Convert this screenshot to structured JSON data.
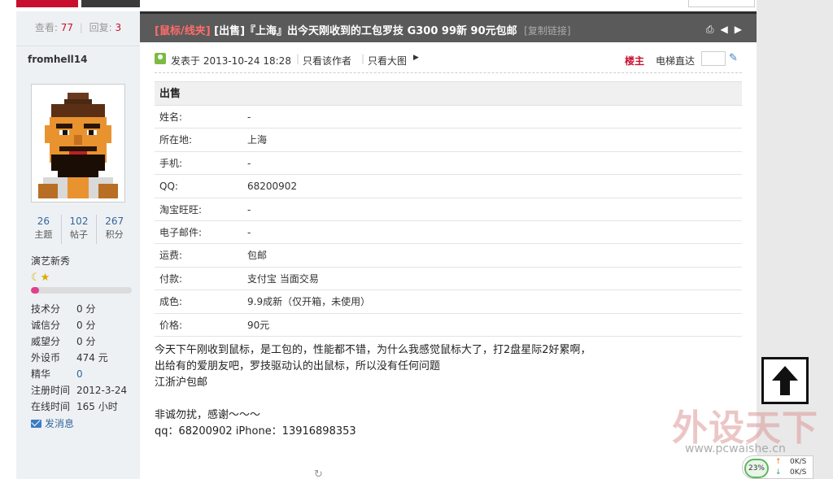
{
  "sidebar": {
    "views_label": "查看:",
    "views": "77",
    "replies_label": "回复:",
    "replies": "3",
    "username": "fromhell14",
    "counts": [
      {
        "num": "26",
        "label": "主题"
      },
      {
        "num": "102",
        "label": "帖子"
      },
      {
        "num": "267",
        "label": "积分"
      }
    ],
    "rank": "演艺新秀",
    "rank_stars": "☾★",
    "progress_fraction": 0.08,
    "info": [
      {
        "key": "技术分",
        "value": "0 分"
      },
      {
        "key": "诚信分",
        "value": "0 分"
      },
      {
        "key": "威望分",
        "value": "0 分"
      },
      {
        "key": "外设币",
        "value": "474 元"
      },
      {
        "key": "精华",
        "value": "0"
      },
      {
        "key": "注册时间",
        "value": "2012-3-24"
      },
      {
        "key": "在线时间",
        "value": "165 小时"
      }
    ],
    "send_message": "发消息"
  },
  "thread": {
    "category": "[鼠标/线夹]",
    "title": "[出售]『上海』出今天刚收到的工包罗技 G300 99新 90元包邮",
    "copy_link": "[复制链接]"
  },
  "post": {
    "posted_at": "发表于 2013-10-24 18:28",
    "only_author": "只看该作者",
    "only_big_image": "只看大图",
    "owner_label": "楼主",
    "elevator_label": "电梯直达"
  },
  "sale_table": {
    "header": "出售",
    "rows": [
      {
        "key": "姓名:",
        "value": "-"
      },
      {
        "key": "所在地:",
        "value": "上海"
      },
      {
        "key": "手机:",
        "value": "-"
      },
      {
        "key": "QQ:",
        "value": "68200902"
      },
      {
        "key": "淘宝旺旺:",
        "value": "-"
      },
      {
        "key": "电子邮件:",
        "value": "-"
      },
      {
        "key": "运费:",
        "value": "包邮"
      },
      {
        "key": "付款:",
        "value": "支付宝 当面交易"
      },
      {
        "key": "成色:",
        "value": "9.9成新（仅开箱，未使用）"
      },
      {
        "key": "价格:",
        "value": "90元"
      }
    ]
  },
  "body": {
    "line1": "今天下午刚收到鼠标，是工包的，性能都不错，为什么我感觉鼠标大了，打2盘星际2好累啊，",
    "line2": "出给有的爱朋友吧，罗技驱动认的出鼠标，所以没有任何问题",
    "line3": "江浙沪包邮",
    "line4": "非诚勿扰，感谢～～～",
    "line5": "qq：68200902   iPhone：13916898353"
  },
  "watermark": {
    "main": "外设天下",
    "url": "www.pcwaishe.cn"
  },
  "net_widget": {
    "percent": "23%",
    "up_arrow": "↑",
    "down_arrow": "↓",
    "up_speed": "0K/S",
    "down_speed": "0K/S"
  },
  "icons": [
    "print-icon",
    "prev-icon",
    "next-icon",
    "user-icon",
    "go-icon",
    "mail-icon",
    "back-to-top-icon",
    "loading-icon"
  ],
  "colors": {
    "accent_red": "#c8102e",
    "link_blue": "#336699",
    "titlebar": "#5a5a5a"
  }
}
